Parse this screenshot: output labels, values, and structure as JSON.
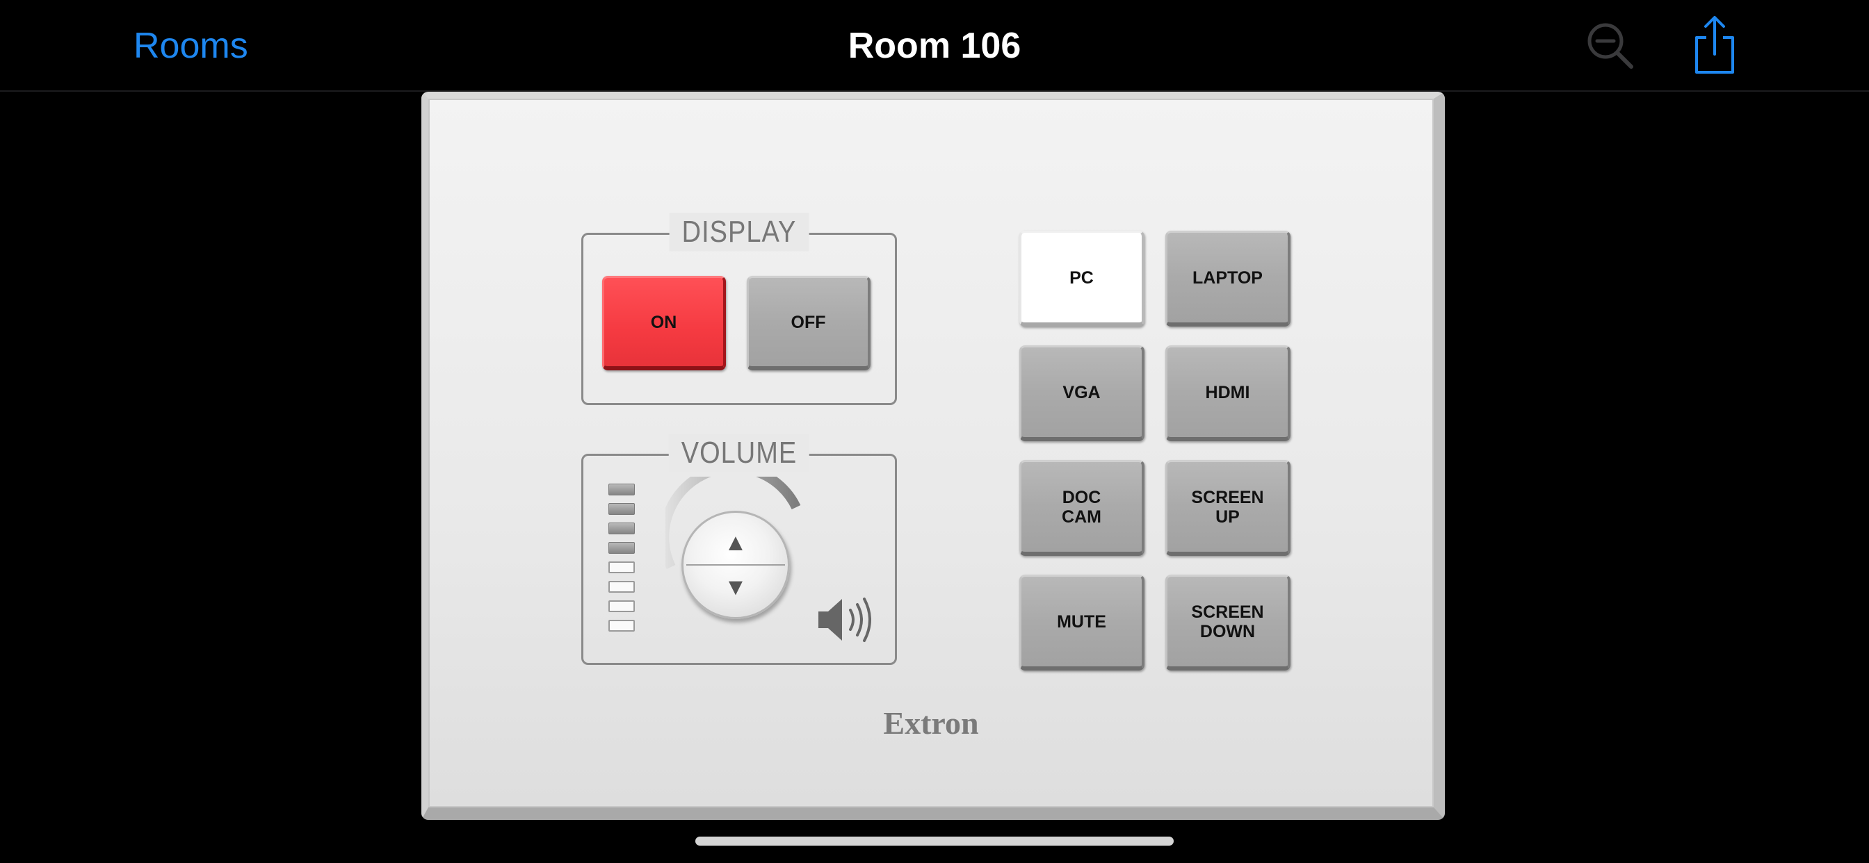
{
  "nav": {
    "back_label": "Rooms",
    "title": "Room 106",
    "zoom_icon": "zoom-out-icon",
    "share_icon": "share-icon",
    "accent_color": "#1e87f0"
  },
  "panel": {
    "display_group": {
      "label": "DISPLAY",
      "on_label": "ON",
      "off_label": "OFF",
      "on_color": "#f53a41"
    },
    "volume_group": {
      "label": "VOLUME",
      "up_symbol": "▲",
      "down_symbol": "▼",
      "level_segments_lit": 4,
      "level_segments_total": 8
    },
    "sources": {
      "pc": "PC",
      "laptop": "LAPTOP",
      "vga": "VGA",
      "hdmi": "HDMI",
      "doc_cam": "DOC\nCAM",
      "screen_up": "SCREEN\nUP",
      "mute": "MUTE",
      "screen_down": "SCREEN\nDOWN",
      "selected": "PC"
    },
    "brand": "Extron"
  }
}
